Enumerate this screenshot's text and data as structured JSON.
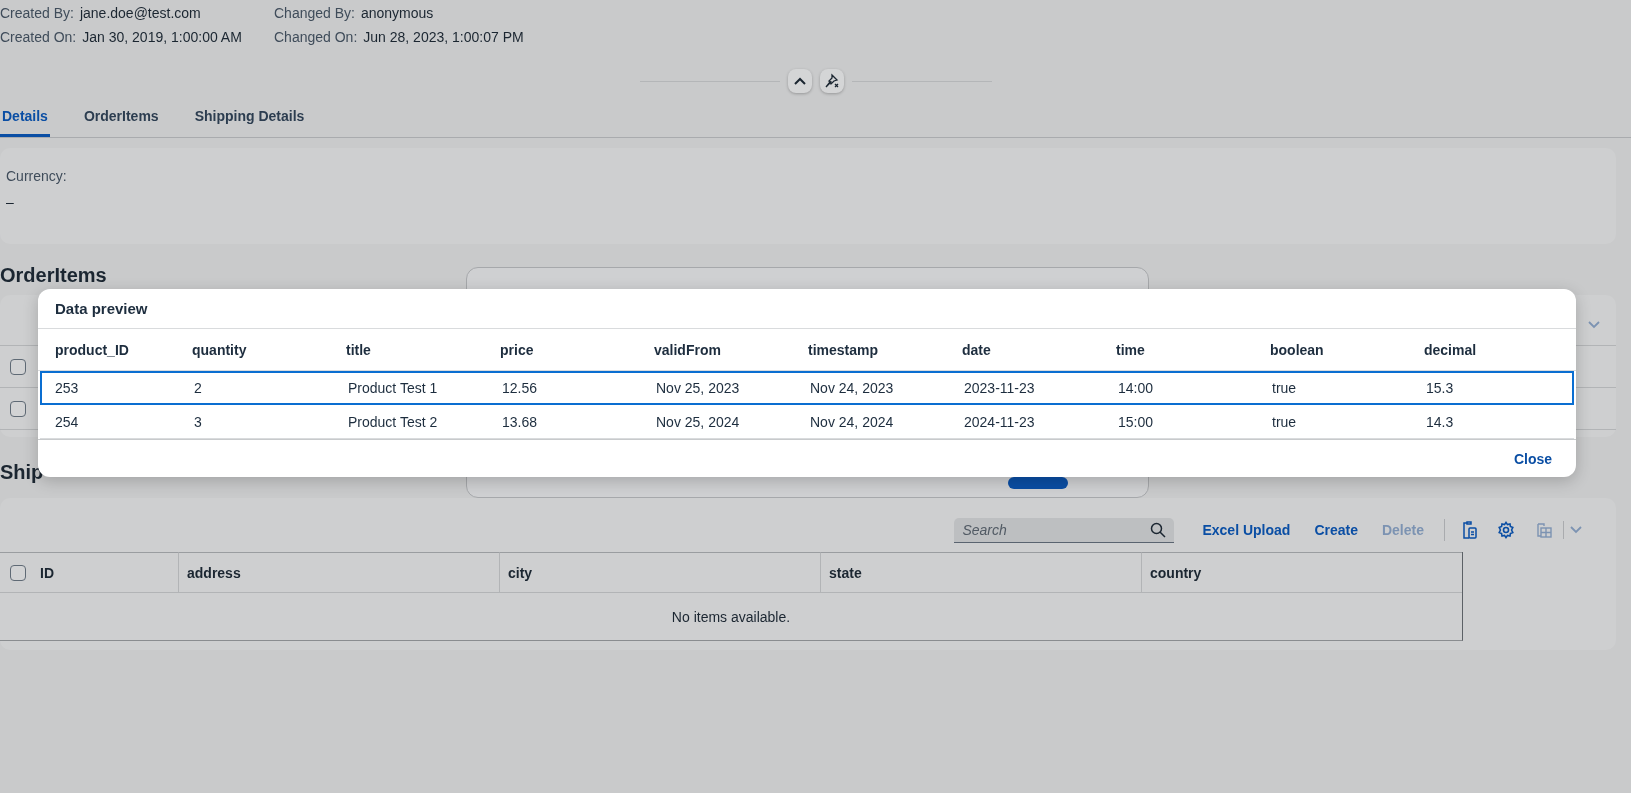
{
  "header": {
    "fields": [
      {
        "label": "Created By:",
        "value": "jane.doe@test.com"
      },
      {
        "label": "Changed By:",
        "value": "anonymous"
      },
      {
        "label": "Created On:",
        "value": "Jan 30, 2019, 1:00:00 AM"
      },
      {
        "label": "Changed On:",
        "value": "Jun 28, 2023, 1:00:07 PM"
      }
    ]
  },
  "tabs": [
    {
      "label": "Details",
      "selected": true
    },
    {
      "label": "OrderItems",
      "selected": false
    },
    {
      "label": "Shipping Details",
      "selected": false
    }
  ],
  "details": {
    "fields": [
      {
        "label": "Currency:",
        "value": "–"
      }
    ]
  },
  "order_items": {
    "title": "OrderItems",
    "rows": [
      {
        "checked": false
      },
      {
        "checked": false
      }
    ]
  },
  "shipping": {
    "title": "Ship",
    "search": {
      "placeholder": "Search"
    },
    "actions": [
      {
        "label": "Excel Upload",
        "disabled": false
      },
      {
        "label": "Create",
        "disabled": false
      },
      {
        "label": "Delete",
        "disabled": true
      }
    ],
    "select_all_checked": false,
    "columns": [
      "ID",
      "address",
      "city",
      "state",
      "country"
    ],
    "empty_text": "No items available."
  },
  "data_preview": {
    "title": "Data preview",
    "columns": [
      "product_ID",
      "quantity",
      "title",
      "price",
      "validFrom",
      "timestamp",
      "date",
      "time",
      "boolean",
      "decimal"
    ],
    "rows": [
      {
        "selected": true,
        "cells": [
          "253",
          "2",
          "Product Test 1",
          "12.56",
          "Nov 25, 2023",
          "Nov 24, 2023",
          "2023-11-23",
          "14:00",
          "true",
          "15.3"
        ]
      },
      {
        "selected": false,
        "cells": [
          "254",
          "3",
          "Product Test 2",
          "13.68",
          "Nov 25, 2024",
          "Nov 24, 2024",
          "2024-11-23",
          "15:00",
          "true",
          "14.3"
        ]
      }
    ],
    "close": "Close"
  }
}
